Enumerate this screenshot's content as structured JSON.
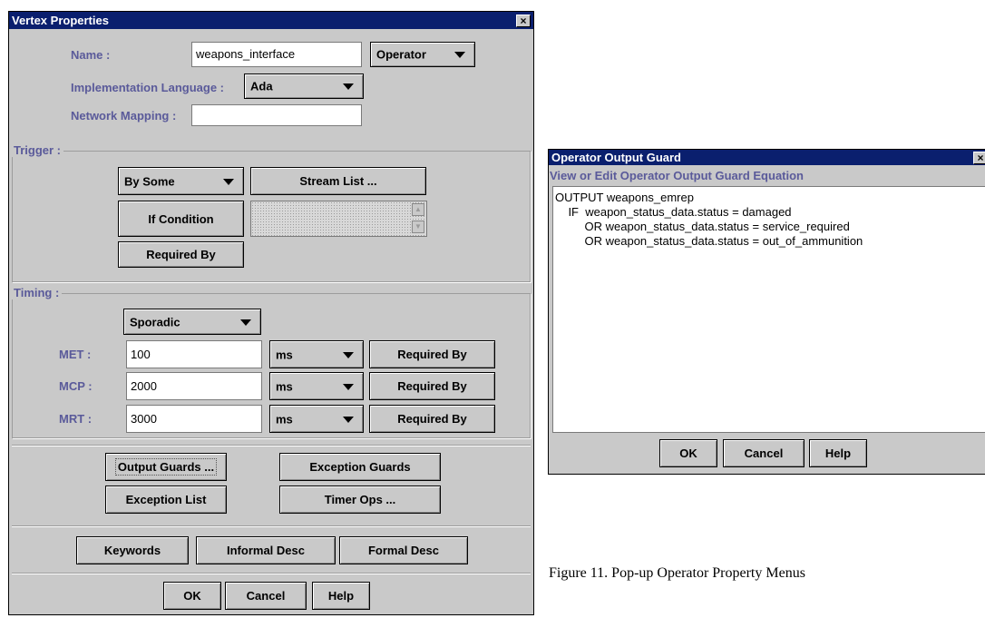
{
  "vertex_window": {
    "title": "Vertex Properties",
    "close_glyph": "×",
    "name_label": "Name :",
    "name_value": "weapons_interface",
    "type_value": "Operator",
    "impl_lang_label": "Implementation Language :",
    "impl_lang_value": "Ada",
    "network_mapping_label": "Network Mapping :",
    "network_mapping_value": "",
    "trigger": {
      "title": "Trigger :",
      "mode_value": "By Some",
      "stream_list_label": "Stream List ...",
      "if_condition_label": "If Condition",
      "required_by_label": "Required By",
      "scroll_up": "▲",
      "scroll_down": "▼"
    },
    "timing": {
      "title": "Timing :",
      "mode_value": "Sporadic",
      "rows": [
        {
          "label": "MET :",
          "value": "100",
          "unit": "ms",
          "button": "Required By"
        },
        {
          "label": "MCP :",
          "value": "2000",
          "unit": "ms",
          "button": "Required By"
        },
        {
          "label": "MRT :",
          "value": "3000",
          "unit": "ms",
          "button": "Required By"
        }
      ]
    },
    "guards": {
      "output_guards": "Output Guards ...",
      "exception_guards": "Exception Guards",
      "exception_list": "Exception List",
      "timer_ops": "Timer Ops ..."
    },
    "desc": {
      "keywords": "Keywords",
      "informal": "Informal Desc",
      "formal": "Formal Desc"
    },
    "footer": {
      "ok": "OK",
      "cancel": "Cancel",
      "help": "Help"
    }
  },
  "guard_window": {
    "title": "Operator Output Guard",
    "close_glyph": "×",
    "subtitle": "View or Edit Operator Output Guard Equation",
    "equation_lines": [
      "OUTPUT weapons_emrep",
      "    IF  weapon_status_data.status = damaged",
      "         OR weapon_status_data.status = service_required",
      "         OR weapon_status_data.status = out_of_ammunition"
    ],
    "footer": {
      "ok": "OK",
      "cancel": "Cancel",
      "help": "Help"
    }
  },
  "caption": "Figure 11. Pop-up Operator Property Menus"
}
